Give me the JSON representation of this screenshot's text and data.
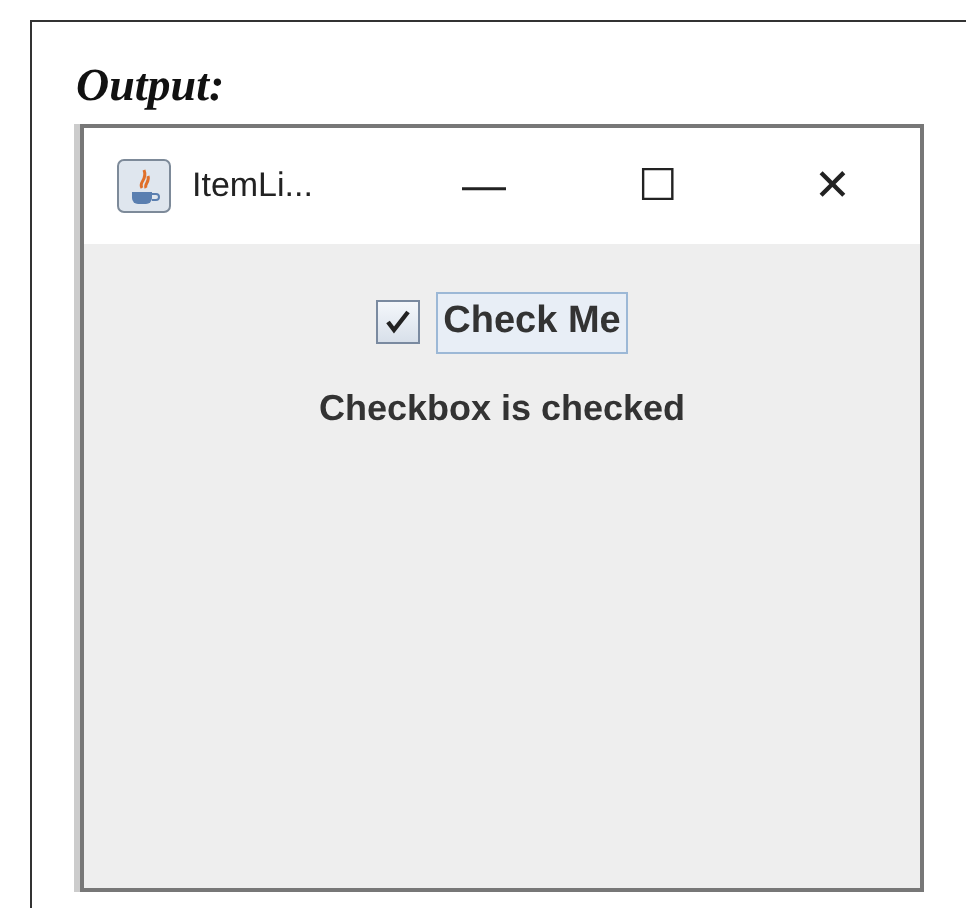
{
  "heading": "Output:",
  "window": {
    "title": "ItemLi...",
    "controls": [
      "—",
      "☐",
      "✕"
    ]
  },
  "checkbox": {
    "label": "Check Me",
    "checked": true,
    "focused": true
  },
  "status_label": "Checkbox is checked"
}
